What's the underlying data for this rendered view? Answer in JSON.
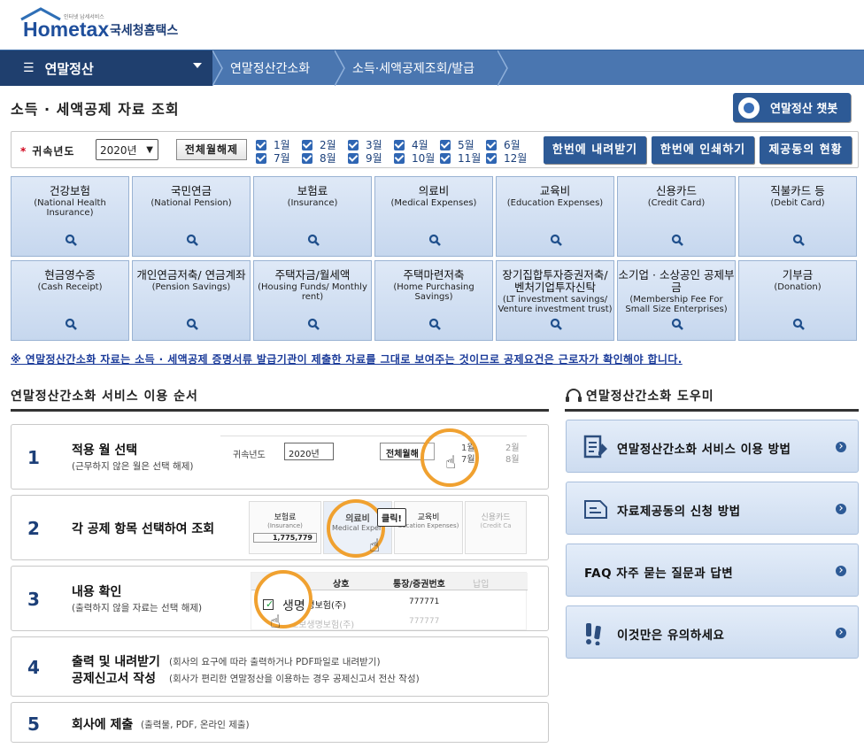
{
  "header": {
    "logo_small": "인터넷 납세서비스",
    "logo_main": "Hometax",
    "logo_kr": "국세청홈택스"
  },
  "nav": {
    "menu_label": "연말정산",
    "breadcrumbs": [
      "연말정산간소화",
      "소득·세액공제조회/발급"
    ]
  },
  "page": {
    "title": "소득 · 세액공제 자료 조회",
    "chatbot_label": "연말정산 챗봇"
  },
  "filter": {
    "year_label": "귀속년도",
    "year_value": "2020년",
    "clear_label": "전체월해제",
    "months": [
      "1월",
      "2월",
      "3월",
      "4월",
      "5월",
      "6월",
      "7월",
      "8월",
      "9월",
      "10월",
      "11월",
      "12월"
    ],
    "download_label": "한번에 내려받기",
    "print_label": "한번에 인쇄하기",
    "status_label": "제공동의 현황"
  },
  "categories": [
    {
      "ko": "건강보험",
      "en": "(National Health Insurance)"
    },
    {
      "ko": "국민연금",
      "en": "(National Pension)"
    },
    {
      "ko": "보험료",
      "en": "(Insurance)"
    },
    {
      "ko": "의료비",
      "en": "(Medical Expenses)"
    },
    {
      "ko": "교육비",
      "en": "(Education Expenses)"
    },
    {
      "ko": "신용카드",
      "en": "(Credit Card)"
    },
    {
      "ko": "직불카드 등",
      "en": "(Debit Card)"
    },
    {
      "ko": "현금영수증",
      "en": "(Cash Receipt)"
    },
    {
      "ko": "개인연금저축/ 연금계좌",
      "en": "(Pension Savings)"
    },
    {
      "ko": "주택자금/월세액",
      "en": "(Housing Funds/ Monthly rent)"
    },
    {
      "ko": "주택마련저축",
      "en": "(Home Purchasing Savings)"
    },
    {
      "ko": "장기집합투자증권저축/ 벤처기업투자신탁",
      "en": "(LT investment savings/ Venture investment trust)"
    },
    {
      "ko": "소기업 · 소상공인 공제부금",
      "en": "(Membership Fee For Small Size Enterprises)"
    },
    {
      "ko": "기부금",
      "en": "(Donation)"
    }
  ],
  "notice": "※ 연말정산간소화 자료는 소득 · 세액공제 증명서류 발급기관이 제출한 자료를 그대로 보여주는 것이므로 공제요건은 근로자가 확인해야 합니다.",
  "steps": {
    "title": "연말정산간소화 서비스 이용 순서",
    "items": [
      {
        "num": "1",
        "title": "적용 월 선택",
        "desc": "(근무하지 않은 월은 선택 해제)"
      },
      {
        "num": "2",
        "title": "각 공제 항목 선택하여 조회",
        "desc": ""
      },
      {
        "num": "3",
        "title": "내용 확인",
        "desc": "(출력하지 않을 자료는 선택 해제)"
      },
      {
        "num": "4",
        "title": "출력 및 내려받기",
        "desc": "(회사의 요구에 따라 출력하거나 PDF파일로 내려받기)",
        "title2": "공제신고서 작성",
        "desc2": "(회사가 편리한 연말정산을 이용하는 경우 공제신고서 전산 작성)"
      },
      {
        "num": "5",
        "title": "회사에 제출",
        "desc": "(출력물, PDF, 온라인 제출)"
      }
    ],
    "ill1": {
      "label": "귀속년도",
      "year": "2020년",
      "btn": "전체월해",
      "m1": "1월",
      "m7": "7월",
      "m2": "2월",
      "m8": "8월"
    },
    "ill2": {
      "c1": "보험료",
      "c1en": "(Insurance)",
      "amount": "1,775,779",
      "c2": "의료비",
      "c2en": "Medical Expen",
      "click": "클릭!",
      "c3": "교육비",
      "c3en": "ducation Expenses)",
      "c4": "신용카드",
      "c4en": "(Credit Ca"
    },
    "ill3": {
      "h1": "상호",
      "h2": "통장/증권번호",
      "h3": "납입",
      "r1": "생명",
      "r1b": "보생명보험(주)",
      "r1n": "777771",
      "r2": "교보생명보험(주)",
      "r2n": "777777"
    }
  },
  "help": {
    "title": "연말정산간소화 도우미",
    "items": [
      {
        "label": "연말정산간소화 서비스 이용 방법",
        "icon": "document-pen-icon"
      },
      {
        "label": "자료제공동의 신청 방법",
        "icon": "document-icon"
      },
      {
        "label": "FAQ 자주 묻는 질문과 답변",
        "icon": "faq-icon"
      },
      {
        "label": "이것만은 유의하세요",
        "icon": "exclamation-icon"
      }
    ]
  }
}
